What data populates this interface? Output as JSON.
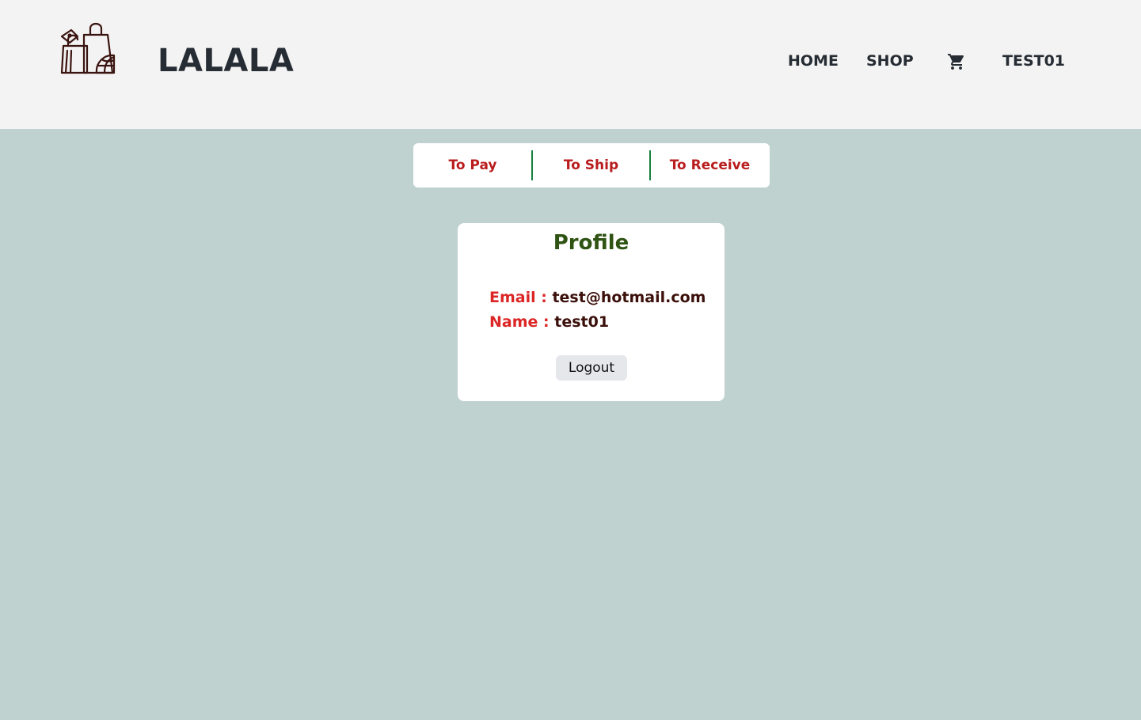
{
  "header": {
    "brand": "LALALA",
    "logo_icon": "shopping-bags-globe-icon",
    "nav": {
      "home": "HOME",
      "shop": "SHOP",
      "cart_icon": "cart-icon",
      "user": "TEST01"
    }
  },
  "order_tabs": [
    {
      "label": "To Pay"
    },
    {
      "label": "To Ship"
    },
    {
      "label": "To Receive"
    }
  ],
  "profile": {
    "title": "Profile",
    "email_label": "Email :",
    "email_value": "test@hotmail.com",
    "name_label": "Name :",
    "name_value": "test01",
    "logout_label": "Logout"
  },
  "colors": {
    "page_bg": "#bfd2d0",
    "header_bg": "#f3f3f3",
    "tab_text": "#b91c1c",
    "tab_divider": "#15803d",
    "profile_title": "#2f5313",
    "field_label": "#dc2626",
    "field_value": "#3b0f0a"
  }
}
